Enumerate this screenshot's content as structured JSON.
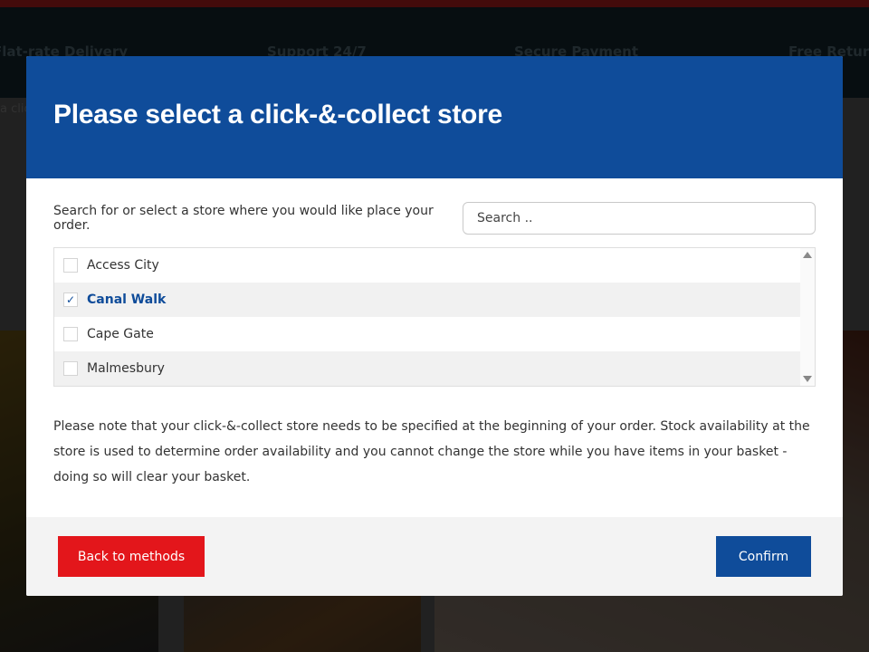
{
  "background": {
    "features": [
      "Flat-rate Delivery",
      "Support 24/7",
      "Secure Payment",
      "Free Returns"
    ],
    "breadcrumb": "a clic"
  },
  "modal": {
    "title": "Please select a click-&-collect store",
    "search_prompt": "Search for or select a store where you would like place your order.",
    "search_placeholder": "Search ..",
    "stores": [
      {
        "name": "Access City",
        "checked": false,
        "mark": ""
      },
      {
        "name": "Canal Walk",
        "checked": true,
        "mark": "✓"
      },
      {
        "name": "Cape Gate",
        "checked": false,
        "mark": ""
      },
      {
        "name": "Malmesbury",
        "checked": false,
        "mark": ""
      }
    ],
    "note": "Please note that your click-&-collect store needs to be specified at the beginning of your order. Stock availability at the store is used to determine order availability and you cannot change the store while you have items in your basket - doing so will clear your basket.",
    "back_label": "Back to methods",
    "confirm_label": "Confirm"
  },
  "colors": {
    "header_blue": "#0f4c9a",
    "back_red": "#e3161b",
    "confirm_blue": "#0f4c9a"
  }
}
